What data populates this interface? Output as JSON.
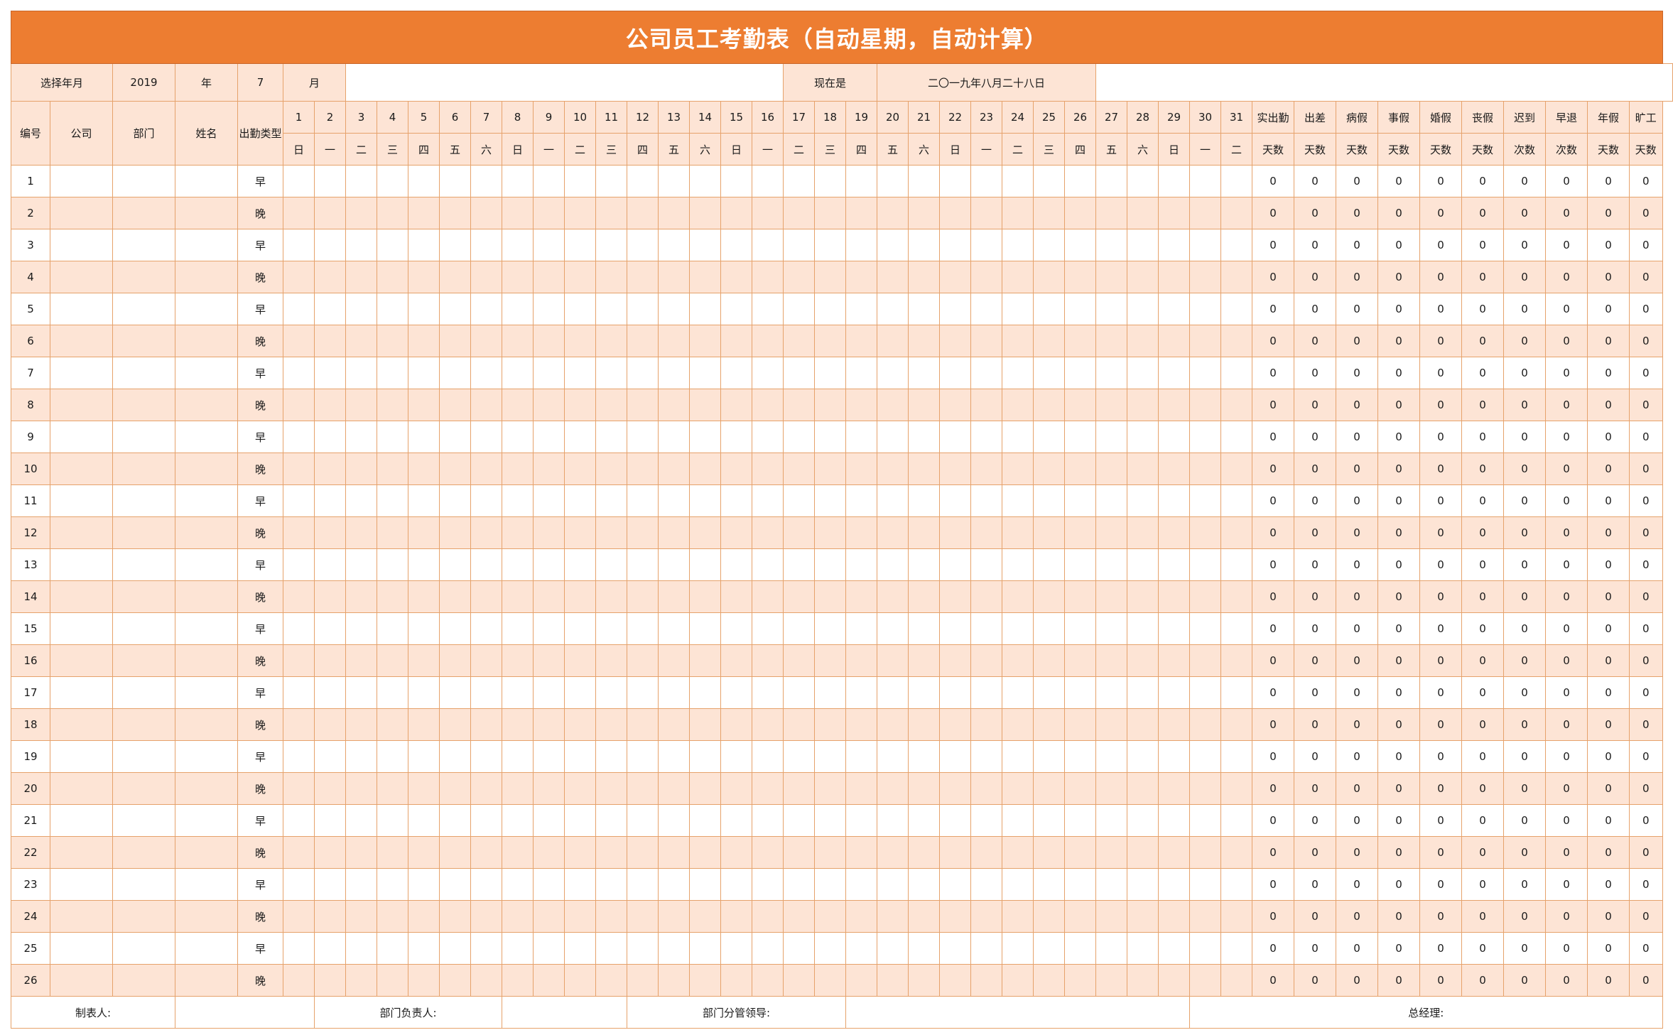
{
  "title": "公司员工考勤表（自动星期，自动计算）",
  "select_row": {
    "select_label": "选择年月",
    "year": "2019",
    "year_unit": "年",
    "month": "7",
    "month_unit": "月",
    "now_label": "现在是",
    "now_value": "二〇一九年八月二十八日"
  },
  "columns": {
    "number": "编号",
    "company": "公司",
    "department": "部门",
    "name": "姓名",
    "attendance_type": "出勤类型"
  },
  "days": [
    "1",
    "2",
    "3",
    "4",
    "5",
    "6",
    "7",
    "8",
    "9",
    "10",
    "11",
    "12",
    "13",
    "14",
    "15",
    "16",
    "17",
    "18",
    "19",
    "20",
    "21",
    "22",
    "23",
    "24",
    "25",
    "26",
    "27",
    "28",
    "29",
    "30",
    "31"
  ],
  "weekdays": [
    "日",
    "一",
    "二",
    "三",
    "四",
    "五",
    "六",
    "日",
    "一",
    "二",
    "三",
    "四",
    "五",
    "六",
    "日",
    "一",
    "二",
    "三",
    "四",
    "五",
    "六",
    "日",
    "一",
    "二",
    "三",
    "四",
    "五",
    "六",
    "日",
    "一",
    "二"
  ],
  "summary": [
    {
      "label": "实出勤",
      "unit": "天数"
    },
    {
      "label": "出差",
      "unit": "天数"
    },
    {
      "label": "病假",
      "unit": "天数"
    },
    {
      "label": "事假",
      "unit": "天数"
    },
    {
      "label": "婚假",
      "unit": "天数"
    },
    {
      "label": "丧假",
      "unit": "天数"
    },
    {
      "label": "迟到",
      "unit": "次数"
    },
    {
      "label": "早退",
      "unit": "次数"
    },
    {
      "label": "年假",
      "unit": "天数"
    },
    {
      "label": "旷工",
      "unit": "天数"
    }
  ],
  "rows": [
    {
      "id": "1",
      "type": "早",
      "totals": [
        "0",
        "0",
        "0",
        "0",
        "0",
        "0",
        "0",
        "0",
        "0",
        "0"
      ]
    },
    {
      "id": "2",
      "type": "晚",
      "totals": [
        "0",
        "0",
        "0",
        "0",
        "0",
        "0",
        "0",
        "0",
        "0",
        "0"
      ]
    },
    {
      "id": "3",
      "type": "早",
      "totals": [
        "0",
        "0",
        "0",
        "0",
        "0",
        "0",
        "0",
        "0",
        "0",
        "0"
      ]
    },
    {
      "id": "4",
      "type": "晚",
      "totals": [
        "0",
        "0",
        "0",
        "0",
        "0",
        "0",
        "0",
        "0",
        "0",
        "0"
      ]
    },
    {
      "id": "5",
      "type": "早",
      "totals": [
        "0",
        "0",
        "0",
        "0",
        "0",
        "0",
        "0",
        "0",
        "0",
        "0"
      ]
    },
    {
      "id": "6",
      "type": "晚",
      "totals": [
        "0",
        "0",
        "0",
        "0",
        "0",
        "0",
        "0",
        "0",
        "0",
        "0"
      ]
    },
    {
      "id": "7",
      "type": "早",
      "totals": [
        "0",
        "0",
        "0",
        "0",
        "0",
        "0",
        "0",
        "0",
        "0",
        "0"
      ]
    },
    {
      "id": "8",
      "type": "晚",
      "totals": [
        "0",
        "0",
        "0",
        "0",
        "0",
        "0",
        "0",
        "0",
        "0",
        "0"
      ]
    },
    {
      "id": "9",
      "type": "早",
      "totals": [
        "0",
        "0",
        "0",
        "0",
        "0",
        "0",
        "0",
        "0",
        "0",
        "0"
      ]
    },
    {
      "id": "10",
      "type": "晚",
      "totals": [
        "0",
        "0",
        "0",
        "0",
        "0",
        "0",
        "0",
        "0",
        "0",
        "0"
      ]
    },
    {
      "id": "11",
      "type": "早",
      "totals": [
        "0",
        "0",
        "0",
        "0",
        "0",
        "0",
        "0",
        "0",
        "0",
        "0"
      ]
    },
    {
      "id": "12",
      "type": "晚",
      "totals": [
        "0",
        "0",
        "0",
        "0",
        "0",
        "0",
        "0",
        "0",
        "0",
        "0"
      ]
    },
    {
      "id": "13",
      "type": "早",
      "totals": [
        "0",
        "0",
        "0",
        "0",
        "0",
        "0",
        "0",
        "0",
        "0",
        "0"
      ]
    },
    {
      "id": "14",
      "type": "晚",
      "totals": [
        "0",
        "0",
        "0",
        "0",
        "0",
        "0",
        "0",
        "0",
        "0",
        "0"
      ]
    },
    {
      "id": "15",
      "type": "早",
      "totals": [
        "0",
        "0",
        "0",
        "0",
        "0",
        "0",
        "0",
        "0",
        "0",
        "0"
      ]
    },
    {
      "id": "16",
      "type": "晚",
      "totals": [
        "0",
        "0",
        "0",
        "0",
        "0",
        "0",
        "0",
        "0",
        "0",
        "0"
      ]
    },
    {
      "id": "17",
      "type": "早",
      "totals": [
        "0",
        "0",
        "0",
        "0",
        "0",
        "0",
        "0",
        "0",
        "0",
        "0"
      ]
    },
    {
      "id": "18",
      "type": "晚",
      "totals": [
        "0",
        "0",
        "0",
        "0",
        "0",
        "0",
        "0",
        "0",
        "0",
        "0"
      ]
    },
    {
      "id": "19",
      "type": "早",
      "totals": [
        "0",
        "0",
        "0",
        "0",
        "0",
        "0",
        "0",
        "0",
        "0",
        "0"
      ]
    },
    {
      "id": "20",
      "type": "晚",
      "totals": [
        "0",
        "0",
        "0",
        "0",
        "0",
        "0",
        "0",
        "0",
        "0",
        "0"
      ]
    },
    {
      "id": "21",
      "type": "早",
      "totals": [
        "0",
        "0",
        "0",
        "0",
        "0",
        "0",
        "0",
        "0",
        "0",
        "0"
      ]
    },
    {
      "id": "22",
      "type": "晚",
      "totals": [
        "0",
        "0",
        "0",
        "0",
        "0",
        "0",
        "0",
        "0",
        "0",
        "0"
      ]
    },
    {
      "id": "23",
      "type": "早",
      "totals": [
        "0",
        "0",
        "0",
        "0",
        "0",
        "0",
        "0",
        "0",
        "0",
        "0"
      ]
    },
    {
      "id": "24",
      "type": "晚",
      "totals": [
        "0",
        "0",
        "0",
        "0",
        "0",
        "0",
        "0",
        "0",
        "0",
        "0"
      ]
    },
    {
      "id": "25",
      "type": "早",
      "totals": [
        "0",
        "0",
        "0",
        "0",
        "0",
        "0",
        "0",
        "0",
        "0",
        "0"
      ]
    },
    {
      "id": "26",
      "type": "晚",
      "totals": [
        "0",
        "0",
        "0",
        "0",
        "0",
        "0",
        "0",
        "0",
        "0",
        "0"
      ]
    }
  ],
  "footer": {
    "preparer": "制表人:",
    "dept_head": "部门负责人:",
    "division_lead": "部门分管领导:",
    "general_manager": "总经理:"
  },
  "colors": {
    "accent": "#ed7d31",
    "stripe": "#fde4d5",
    "grid": "#e6a26b"
  }
}
